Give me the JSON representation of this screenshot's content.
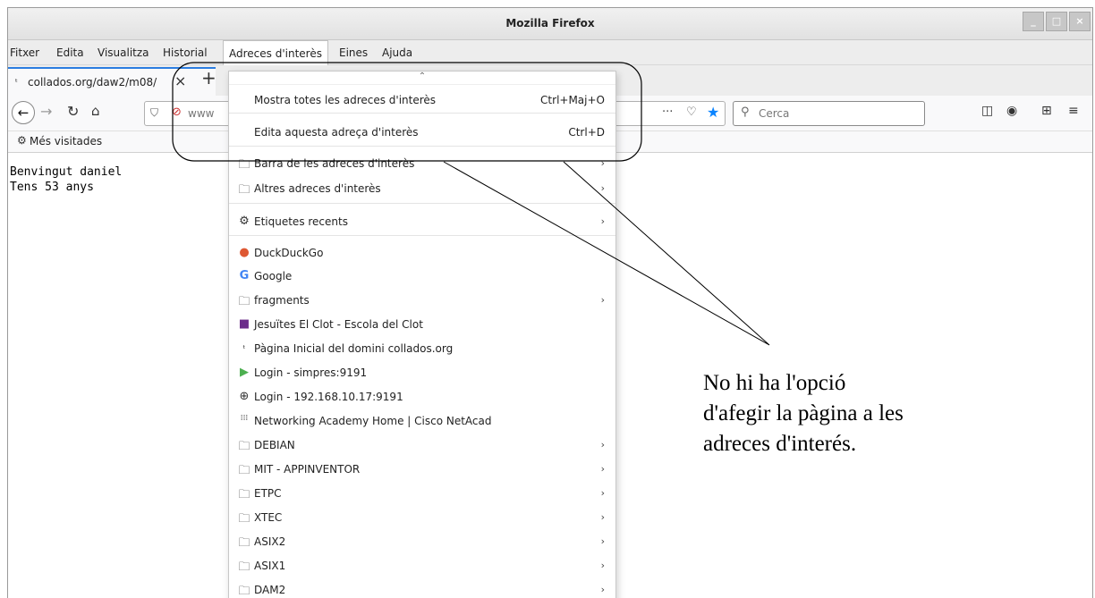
{
  "window": {
    "title": "Mozilla Firefox",
    "buttons": [
      "_",
      "□",
      "×"
    ]
  },
  "menubar": {
    "items": [
      "Fitxer",
      "Edita",
      "Visualitza",
      "Historial",
      "Adreces d'interès",
      "Eines",
      "Ajuda"
    ]
  },
  "tab": {
    "title": "collados.org/daw2/m08/",
    "close": "×",
    "new_tab": "+"
  },
  "navbar": {
    "url_text": "www",
    "search_placeholder": "Cerca"
  },
  "bookmarks_toolbar": {
    "most_visited": "Més visitades"
  },
  "page": {
    "line1": "Benvingut daniel",
    "line2": "Tens 53 anys"
  },
  "menu": {
    "show_all": "Mostra totes les adreces d'interès",
    "show_all_shortcut": "Ctrl+Maj+O",
    "edit_bookmark": "Edita aquesta adreça d'interès",
    "edit_bookmark_shortcut": "Ctrl+D",
    "items": [
      {
        "label": "Barra de les adreces d'interès",
        "icon": "folder-icon",
        "submenu": true
      },
      {
        "label": "Altres adreces d'interès",
        "icon": "folder-icon",
        "submenu": true
      },
      {
        "label": "Etiquetes recents",
        "icon": "gear-icon",
        "submenu": true
      },
      {
        "label": "DuckDuckGo",
        "icon": "duckduckgo-icon",
        "submenu": false
      },
      {
        "label": "Google",
        "icon": "google-icon",
        "submenu": false
      },
      {
        "label": "fragments",
        "icon": "folder-icon",
        "submenu": true
      },
      {
        "label": "Jesuïtes El Clot - Escola del Clot",
        "icon": "jesuites-icon",
        "submenu": false
      },
      {
        "label": "Pàgina Inicial del domini collados.org",
        "icon": "collados-icon",
        "submenu": false
      },
      {
        "label": "Login - simpres:9191",
        "icon": "papercut-icon",
        "submenu": false
      },
      {
        "label": "Login - 192.168.10.17:9191",
        "icon": "globe-icon",
        "submenu": false
      },
      {
        "label": "Networking Academy Home | Cisco NetAcad",
        "icon": "cisco-icon",
        "submenu": false
      },
      {
        "label": "DEBIAN",
        "icon": "folder-icon",
        "submenu": true
      },
      {
        "label": "MIT - APPINVENTOR",
        "icon": "folder-icon",
        "submenu": true
      },
      {
        "label": "ETPC",
        "icon": "folder-icon",
        "submenu": true
      },
      {
        "label": "XTEC",
        "icon": "folder-icon",
        "submenu": true
      },
      {
        "label": "ASIX2",
        "icon": "folder-icon",
        "submenu": true
      },
      {
        "label": "ASIX1",
        "icon": "folder-icon",
        "submenu": true
      },
      {
        "label": "DAM2",
        "icon": "folder-icon",
        "submenu": true
      }
    ]
  },
  "annotation": {
    "line1": "No hi ha l'opció",
    "line2": "d'afegir la pàgina a les",
    "line3": "adreces d'interés."
  }
}
